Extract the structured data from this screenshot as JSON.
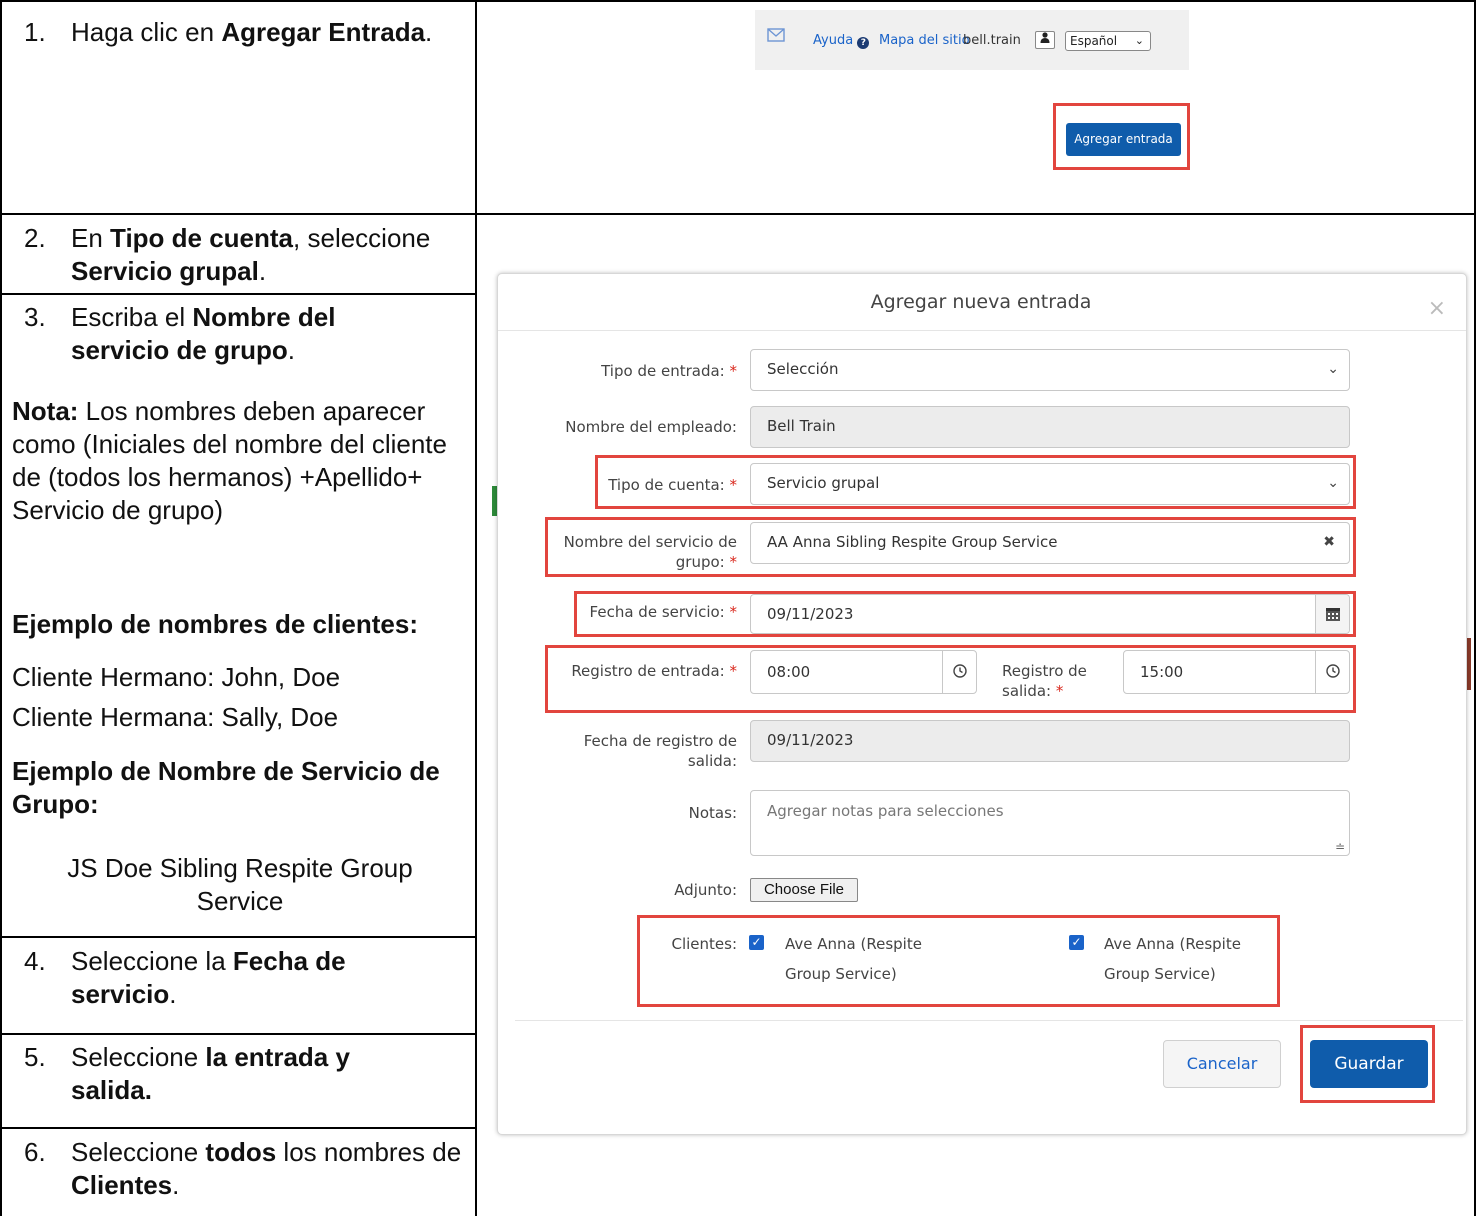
{
  "steps": [
    {
      "num": "1.",
      "pre": "Haga clic en ",
      "bold": "Agregar Entrada",
      "post": "."
    },
    {
      "num": "2.",
      "pre": "En ",
      "bold": "Tipo de cuenta",
      "mid": ", seleccione ",
      "bold2": "Servicio grupal",
      "post": "."
    },
    {
      "num": "3.",
      "pre": "Escriba el ",
      "bold": "Nombre del servicio de grupo",
      "post": "."
    },
    {
      "num": "4.",
      "pre": "Seleccione la ",
      "bold": "Fecha de servicio",
      "post": "."
    },
    {
      "num": "5.",
      "pre": "Seleccione ",
      "bold": "la entrada y salida."
    },
    {
      "num": "6.",
      "pre": "Seleccione ",
      "bold": "todos",
      "mid": " los nombres de ",
      "bold2": "Clientes",
      "post": "."
    }
  ],
  "note": {
    "bold": "Nota:",
    "text": " Los nombres deben aparecer como (Iniciales del nombre del cliente de (todos los hermanos) +Apellido+ Servicio de grupo)"
  },
  "example_clients": {
    "heading": "Ejemplo de nombres de clientes:",
    "line1": "Cliente Hermano: John, Doe",
    "line2": "Cliente Hermana: Sally, Doe"
  },
  "example_group": {
    "heading": "Ejemplo de Nombre de Servicio de Grupo:",
    "value": "JS Doe Sibling Respite Group Service"
  },
  "topbar": {
    "help": "Ayuda",
    "sitemap": "Mapa del sitio",
    "user": "bell.train",
    "language": "Español"
  },
  "add_entry_button": "Agregar entrada",
  "modal": {
    "title": "Agregar nueva entrada",
    "entry_type_label": "Tipo de entrada:",
    "entry_type_value": "Selección",
    "employee_label": "Nombre del empleado:",
    "employee_value": "Bell Train",
    "account_type_label": "Tipo de cuenta:",
    "account_type_value": "Servicio grupal",
    "group_name_label_1": "Nombre del servicio de",
    "group_name_label_2": "grupo:",
    "group_name_value": "AA Anna Sibling Respite Group Service",
    "service_date_label": "Fecha de servicio:",
    "service_date_value": "09/11/2023",
    "check_in_label": "Registro de entrada:",
    "check_in_value": "08:00",
    "check_out_label_1": "Registro de",
    "check_out_label_2": "salida:",
    "check_out_value": "15:00",
    "checkout_date_label_1": "Fecha de registro de",
    "checkout_date_label_2": "salida:",
    "checkout_date_value": "09/11/2023",
    "notes_label": "Notas:",
    "notes_placeholder": "Agregar notas para selecciones",
    "attachment_label": "Adjunto:",
    "choose_file": "Choose File",
    "clients_label": "Clientes:",
    "clients": [
      {
        "line1": "Ave Anna (Respite",
        "line2": "Group Service)",
        "checked": true
      },
      {
        "line1": "Ave Anna (Respite",
        "line2": "Group Service)",
        "checked": true
      }
    ],
    "cancel": "Cancelar",
    "save": "Guardar",
    "required_mark": "*"
  },
  "colors": {
    "highlight": "#e2453e",
    "primary": "#0f5cab",
    "link": "#1a63c9",
    "required": "#d9281d"
  }
}
